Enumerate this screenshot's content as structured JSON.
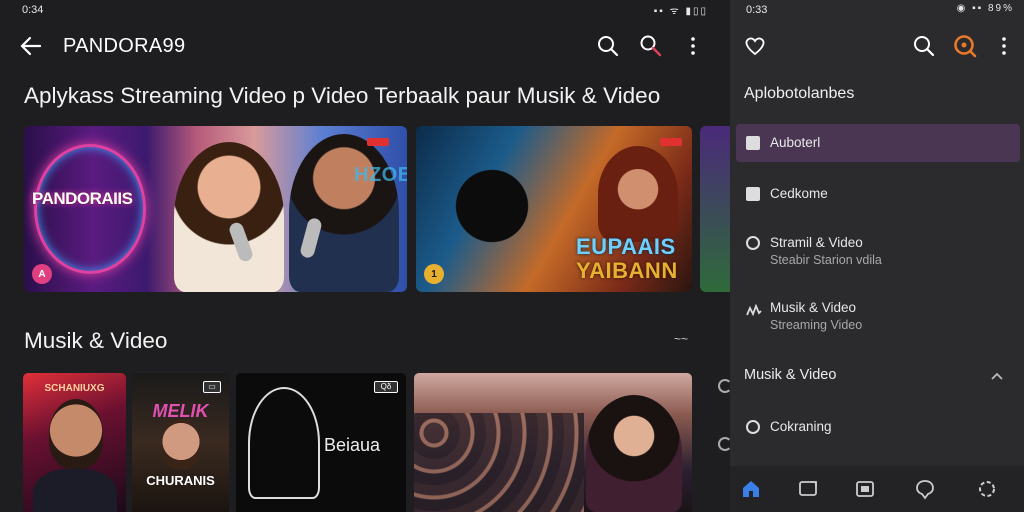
{
  "left": {
    "status": {
      "time": "0:34",
      "icons": "▪▪ ᯤ ▮▯▯"
    },
    "app_title": "PANDORA99",
    "icons": {
      "back": "back-arrow-icon",
      "search": "search-icon",
      "search_alt": "search-zoom-icon",
      "menu": "more-vertical-icon"
    },
    "headline": "Aplykass Streaming Video p Video Terbaalk paur Musik & Video",
    "hero": [
      {
        "logo": "PANDORAIIS",
        "sub_text": "HZOB",
        "corner": "A",
        "accent": "#e040a0"
      },
      {
        "line1": "EUPAAIS",
        "line2": "YAIBANN",
        "corner": "1",
        "accent": "#e8b030"
      }
    ],
    "section_title": "Musik & Video",
    "more_label": "~~",
    "thumbnails": [
      {
        "title": "SCHANIUXG"
      },
      {
        "title_top": "MELIK",
        "title_bottom": "CHURANIS",
        "badge": "▭"
      },
      {
        "title": "Beiaua",
        "badge": "Qδ"
      },
      {
        "label": ""
      }
    ]
  },
  "drawer": {
    "status": {
      "time": "0:33",
      "icons": "◉ ▪▪ 89%"
    },
    "icons": {
      "favorite": "heart-icon",
      "search": "search-icon",
      "search_active": "search-active-icon",
      "menu": "more-vertical-icon"
    },
    "header": "Aplobotolanbes",
    "items": [
      {
        "label": "Auboterl",
        "icon": "play-icon",
        "active": true
      },
      {
        "label": "Cedkome",
        "icon": "bookmark-icon",
        "active": false
      },
      {
        "label": "Stramil & Video",
        "sub": "Steabir Starion vdila",
        "icon": "radio-icon",
        "active": false
      },
      {
        "label": "Musik & Video",
        "sub": "Streaming Video",
        "icon": "waveform-icon",
        "active": false
      }
    ],
    "section": "Musik & Video",
    "section_item": {
      "label": "Cokraning",
      "icon": "disc-icon"
    },
    "bottom_nav": [
      "home-icon",
      "screen-icon",
      "library-icon",
      "chat-icon",
      "settings-icon"
    ],
    "accent": "#e8782a",
    "nav_active": "#3a7ee8"
  }
}
